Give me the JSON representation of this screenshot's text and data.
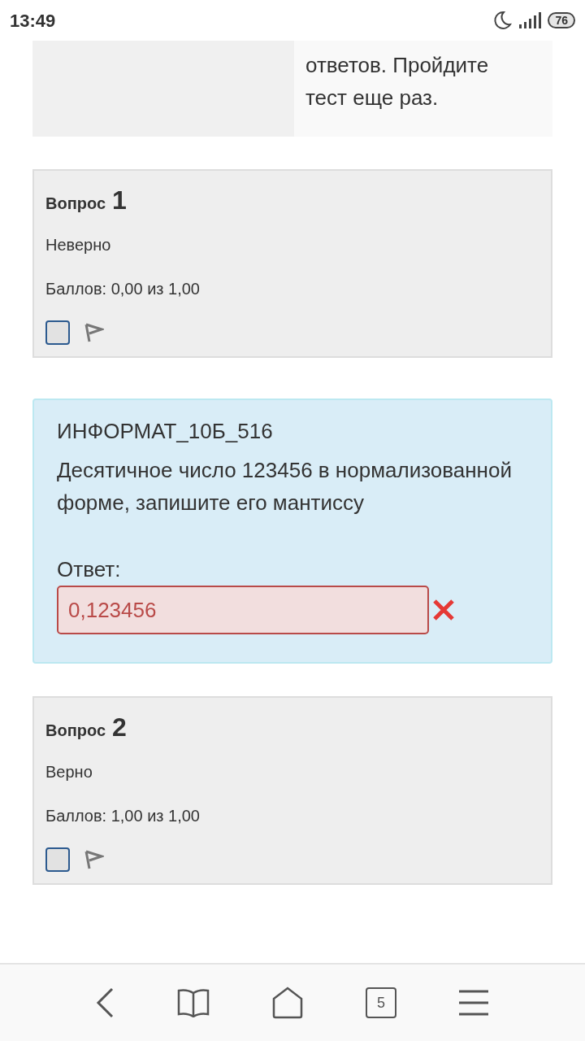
{
  "status_bar": {
    "time": "13:49",
    "battery": "76"
  },
  "feedback": {
    "lines": [
      "ответов. Пройдите",
      "тест еще раз."
    ]
  },
  "questions": [
    {
      "kind": "info",
      "label": "Вопрос",
      "number": "1",
      "state": "Неверно",
      "grade": "Баллов: 0,00 из 1,00",
      "flagged": false
    },
    {
      "kind": "content",
      "code": "ИНФОРМАТ_10Б_516",
      "text": "Десятичное число 123456 в нормализованной форме, запишите его мантиссу",
      "answer_label": "Ответ:",
      "answer": "0,123456",
      "correct": false
    },
    {
      "kind": "info",
      "label": "Вопрос",
      "number": "2",
      "state": "Верно",
      "grade": "Баллов: 1,00 из 1,00",
      "flagged": false
    }
  ],
  "browser_bar": {
    "tabs_count": "5"
  }
}
